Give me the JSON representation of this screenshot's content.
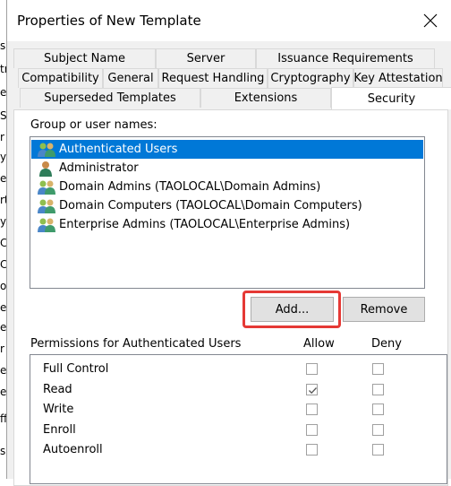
{
  "window": {
    "title": "Properties of New Template"
  },
  "background_glyphs": [
    "s",
    "tr",
    "e",
    "S",
    "r",
    "y",
    "e",
    "rt",
    "y",
    "C",
    "C",
    "ov",
    "er",
    "er",
    "r",
    "e",
    "e",
    "ff",
    "s"
  ],
  "tabs": {
    "row1": [
      "Subject Name",
      "Server",
      "Issuance Requirements"
    ],
    "row2": [
      "Compatibility",
      "General",
      "Request Handling",
      "Cryptography",
      "Key Attestation"
    ],
    "row3": [
      "Superseded Templates",
      "Extensions",
      "Security"
    ],
    "active": "Security"
  },
  "security": {
    "group_label": "Group or user names:",
    "users": [
      {
        "name": "Authenticated Users",
        "icon": "group-icon",
        "selected": true
      },
      {
        "name": "Administrator",
        "icon": "user-icon",
        "selected": false
      },
      {
        "name": "Domain Admins (TAOLOCAL\\Domain Admins)",
        "icon": "group-icon",
        "selected": false
      },
      {
        "name": "Domain Computers (TAOLOCAL\\Domain Computers)",
        "icon": "group-icon",
        "selected": false
      },
      {
        "name": "Enterprise Admins (TAOLOCAL\\Enterprise Admins)",
        "icon": "group-icon",
        "selected": false
      }
    ],
    "add_label": "Add...",
    "remove_label": "Remove",
    "permissions_label": "Permissions for Authenticated Users",
    "allow_label": "Allow",
    "deny_label": "Deny",
    "permissions": [
      {
        "name": "Full Control",
        "allow": false,
        "deny": false
      },
      {
        "name": "Read",
        "allow": true,
        "deny": false
      },
      {
        "name": "Write",
        "allow": false,
        "deny": false
      },
      {
        "name": "Enroll",
        "allow": false,
        "deny": false
      },
      {
        "name": "Autoenroll",
        "allow": false,
        "deny": false
      }
    ]
  },
  "colors": {
    "selection": "#0078d7",
    "highlight_border": "#e53935"
  }
}
